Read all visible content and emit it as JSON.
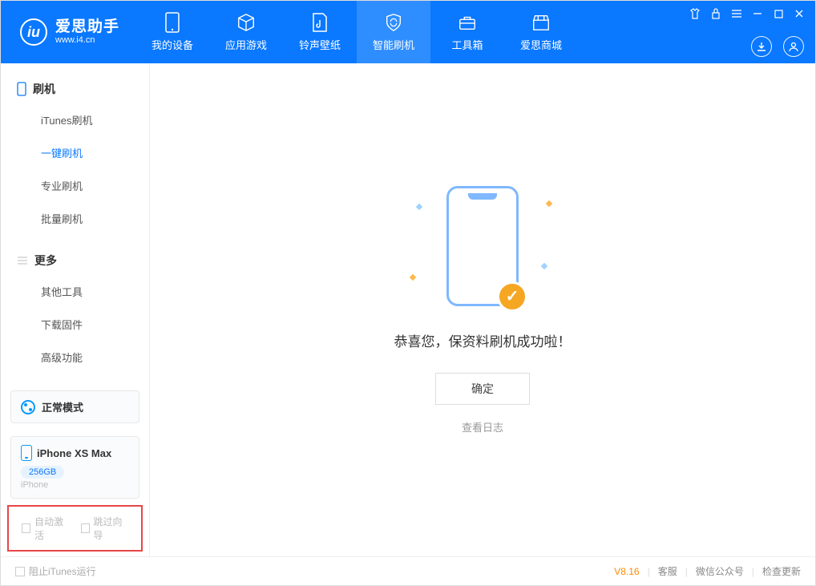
{
  "app": {
    "title": "爱思助手",
    "url": "www.i4.cn"
  },
  "tabs": [
    {
      "label": "我的设备"
    },
    {
      "label": "应用游戏"
    },
    {
      "label": "铃声壁纸"
    },
    {
      "label": "智能刷机"
    },
    {
      "label": "工具箱"
    },
    {
      "label": "爱思商城"
    }
  ],
  "sidebar": {
    "section1": {
      "title": "刷机",
      "items": [
        "iTunes刷机",
        "一键刷机",
        "专业刷机",
        "批量刷机"
      ]
    },
    "section2": {
      "title": "更多",
      "items": [
        "其他工具",
        "下载固件",
        "高级功能"
      ]
    }
  },
  "mode": {
    "label": "正常模式"
  },
  "device": {
    "name": "iPhone XS Max",
    "capacity": "256GB",
    "type": "iPhone"
  },
  "checkboxes": {
    "auto_activate": "自动激活",
    "skip_guide": "跳过向导"
  },
  "main": {
    "success_text": "恭喜您，保资料刷机成功啦！",
    "ok_button": "确定",
    "view_log": "查看日志"
  },
  "footer": {
    "block_itunes": "阻止iTunes运行",
    "version": "V8.16",
    "links": [
      "客服",
      "微信公众号",
      "检查更新"
    ]
  }
}
